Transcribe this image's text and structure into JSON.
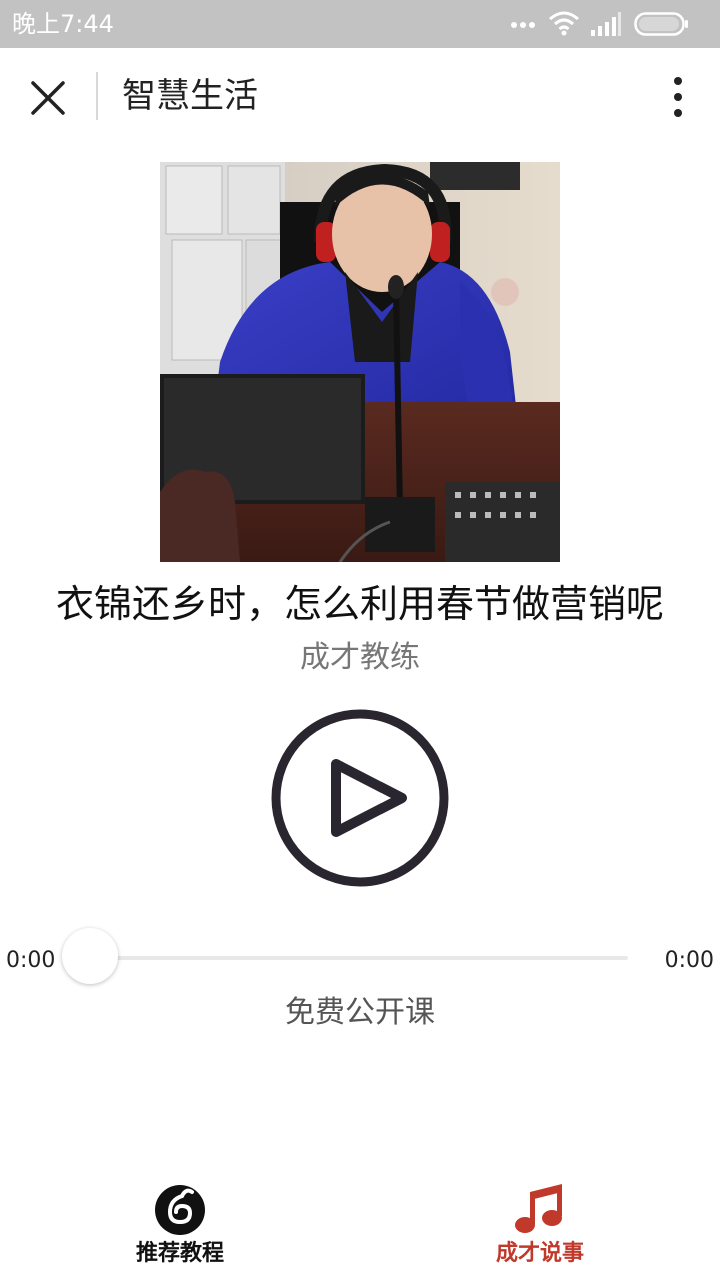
{
  "status_bar": {
    "time": "晚上7:44"
  },
  "header": {
    "title": "智慧生活"
  },
  "player": {
    "track_title": "衣锦还乡时，怎么利用春节做营销呢",
    "author": "成才教练",
    "time_current": "0:00",
    "time_total": "0:00",
    "progress": 0,
    "course_tag": "免费公开课"
  },
  "bottom_nav": {
    "items": [
      {
        "label": "推荐教程",
        "icon": "netease-music-icon",
        "color": "#111111",
        "active": false
      },
      {
        "label": "成才说事",
        "icon": "music-note-icon",
        "color": "#c0392b",
        "active": true
      }
    ]
  },
  "colors": {
    "accent": "#c0392b",
    "status_bar_bg": "#c2c2c2",
    "play_ring": "#2a2630"
  }
}
